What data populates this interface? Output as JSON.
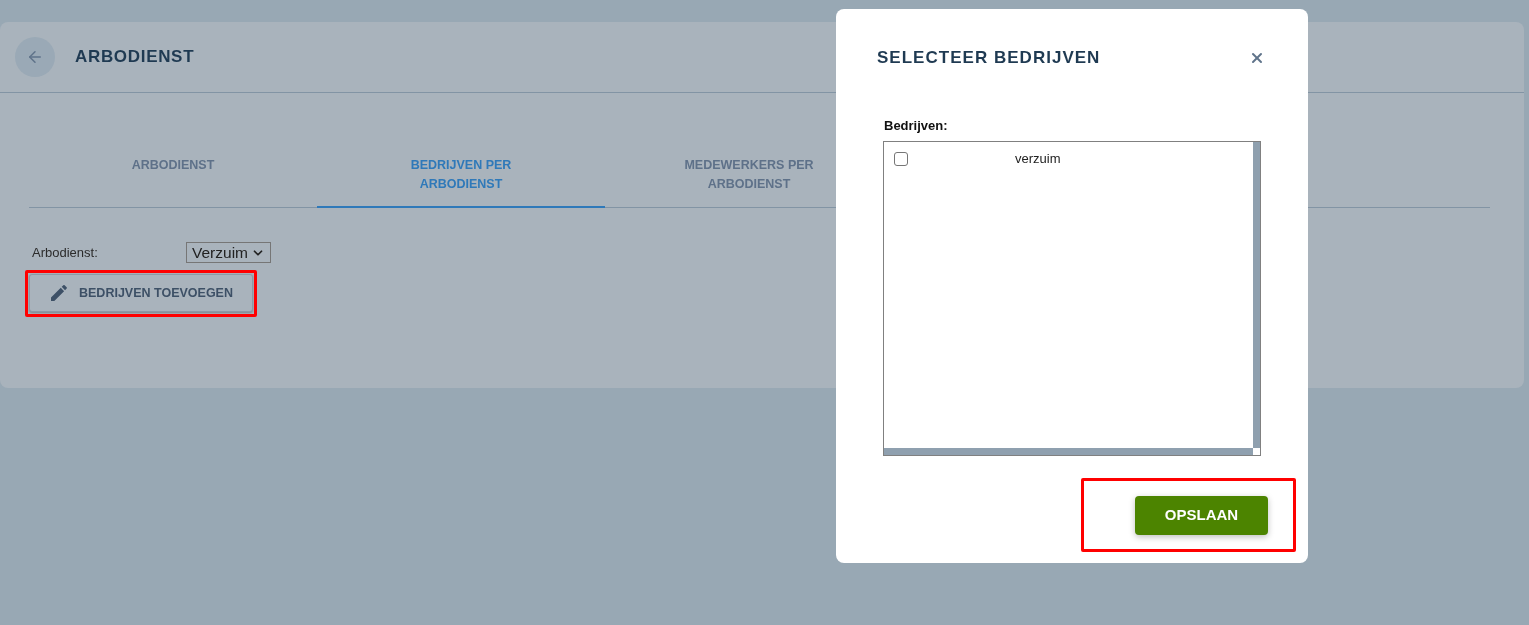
{
  "page": {
    "title": "ARBODIENST"
  },
  "tabs": [
    {
      "label": "ARBODIENST",
      "selected": false
    },
    {
      "label": "BEDRIJVEN PER ARBODIENST",
      "selected": true
    },
    {
      "label": "MEDEWERKERS PER ARBODIENST",
      "selected": false
    }
  ],
  "filter": {
    "label": "Arbodienst:",
    "value": "Verzuim"
  },
  "add_button": {
    "label": "BEDRIJVEN TOEVOEGEN",
    "highlighted": true
  },
  "dialog": {
    "title": "SELECTEER BEDRIJVEN",
    "list_label": "Bedrijven:",
    "items": [
      {
        "label": "verzuim",
        "checked": false
      }
    ],
    "save_button": {
      "label": "OPSLAAN",
      "highlighted": true
    }
  }
}
